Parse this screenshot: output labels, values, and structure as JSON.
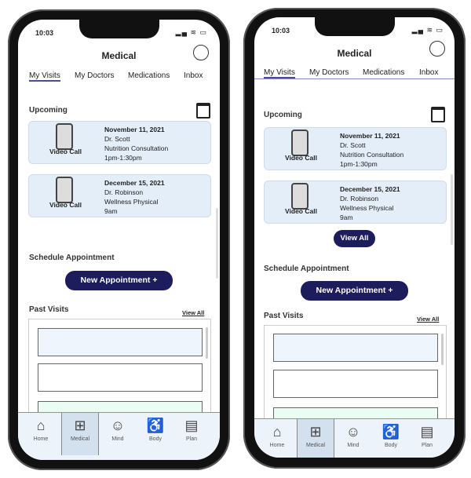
{
  "status": {
    "time": "10:03",
    "icons": "signal-wifi-battery"
  },
  "header": {
    "title": "Medical"
  },
  "tabs": [
    "My Visits",
    "My Doctors",
    "Medications",
    "Inbox"
  ],
  "upcoming": {
    "label": "Upcoming",
    "appointments": [
      {
        "type": "Video Call",
        "date": "November 11, 2021",
        "doctor": "Dr. Scott",
        "reason": "Nutrition Consultation",
        "time": "1pm-1:30pm"
      },
      {
        "type": "Video Call",
        "date": "December 15, 2021",
        "doctor": "Dr.  Robinson",
        "reason": "Wellness Physical",
        "time": "9am"
      }
    ],
    "view_all": "View All"
  },
  "schedule": {
    "label": "Schedule Appointment",
    "button": "New Appointment  +"
  },
  "past": {
    "label": "Past Visits",
    "view_all": "View All"
  },
  "nav": [
    "Home",
    "Medical",
    "Mind",
    "Body",
    "Plan"
  ],
  "colors": {
    "accent": "#1d1d5e",
    "card": "#e4eef8",
    "nav": "#edf3fa",
    "tab_underline": "#4b4b8f"
  }
}
